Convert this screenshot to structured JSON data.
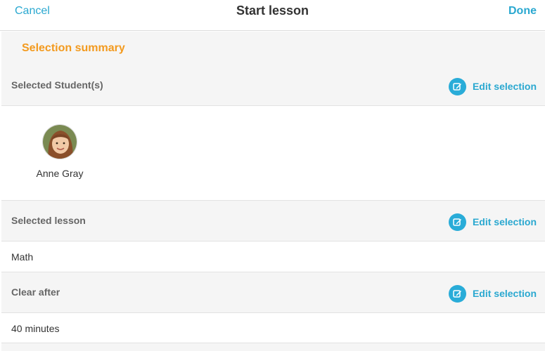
{
  "navbar": {
    "cancel_label": "Cancel",
    "title": "Start lesson",
    "done_label": "Done"
  },
  "summary": {
    "title": "Selection summary"
  },
  "students_section": {
    "label": "Selected Student(s)",
    "edit_label": "Edit selection",
    "students": [
      {
        "name": "Anne Gray",
        "avatar": "student-photo"
      }
    ]
  },
  "lesson_section": {
    "label": "Selected lesson",
    "edit_label": "Edit selection",
    "value": "Math"
  },
  "clear_section": {
    "label": "Clear after",
    "edit_label": "Edit selection",
    "value": "40 minutes"
  },
  "icons": {
    "edit": "edit-pencil-icon"
  },
  "colors": {
    "accent": "#2aa8d0",
    "summary_title": "#f39a1e",
    "header_bg": "#f5f5f5"
  }
}
